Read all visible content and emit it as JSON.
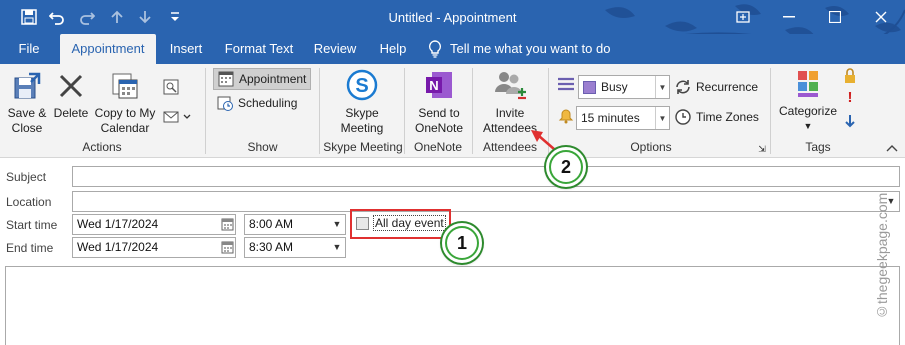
{
  "window": {
    "title": "Untitled  -  Appointment",
    "restore_label": "▢",
    "minimize_label": "—",
    "maximize_label": "☐",
    "close_label": "✕"
  },
  "quick_access": {
    "save": "save-icon",
    "undo": "undo-icon",
    "redo": "redo-icon",
    "up": "up-icon",
    "down": "down-icon",
    "customize": "customize-icon"
  },
  "tabs": [
    {
      "label": "File"
    },
    {
      "label": "Appointment"
    },
    {
      "label": "Insert"
    },
    {
      "label": "Format Text"
    },
    {
      "label": "Review"
    },
    {
      "label": "Help"
    }
  ],
  "tell_me": "Tell me what you want to do",
  "ribbon": {
    "actions": {
      "save_close": "Save &\nClose",
      "save_line1": "Save &",
      "save_line2": "Close",
      "delete": "Delete",
      "copy_line1": "Copy to My",
      "copy_line2": "Calendar",
      "group": "Actions"
    },
    "show": {
      "appointment": "Appointment",
      "scheduling": "Scheduling",
      "group": "Show"
    },
    "skype": {
      "line1": "Skype",
      "line2": "Meeting",
      "group": "Skype Meeting"
    },
    "onenote": {
      "line1": "Send to",
      "line2": "OneNote",
      "group": "OneNote"
    },
    "attendees": {
      "line1": "Invite",
      "line2": "Attendees",
      "group": "Attendees"
    },
    "options": {
      "show_as": "Busy",
      "reminder": "15 minutes",
      "recurrence": "Recurrence",
      "time_zones": "Time Zones",
      "group": "Options"
    },
    "tags": {
      "categorize": "Categorize",
      "group": "Tags"
    }
  },
  "form": {
    "subject_label": "Subject",
    "subject_value": "",
    "location_label": "Location",
    "location_value": "",
    "start_label": "Start time",
    "start_date": "Wed 1/17/2024",
    "start_time": "8:00 AM",
    "end_label": "End time",
    "end_date": "Wed 1/17/2024",
    "end_time": "8:30 AM",
    "all_day_label": "All day event",
    "all_day_checked": false
  },
  "annotations": {
    "callout_1": "1",
    "callout_2": "2",
    "highlight_color": "#e03030",
    "callout_color": "#3aa63a"
  },
  "watermark": "©thegeekpage.com",
  "colors": {
    "title_bar": "#2a64b0",
    "ribbon_bg": "#f3f3f3",
    "busy_color": "#9b7fd0"
  }
}
